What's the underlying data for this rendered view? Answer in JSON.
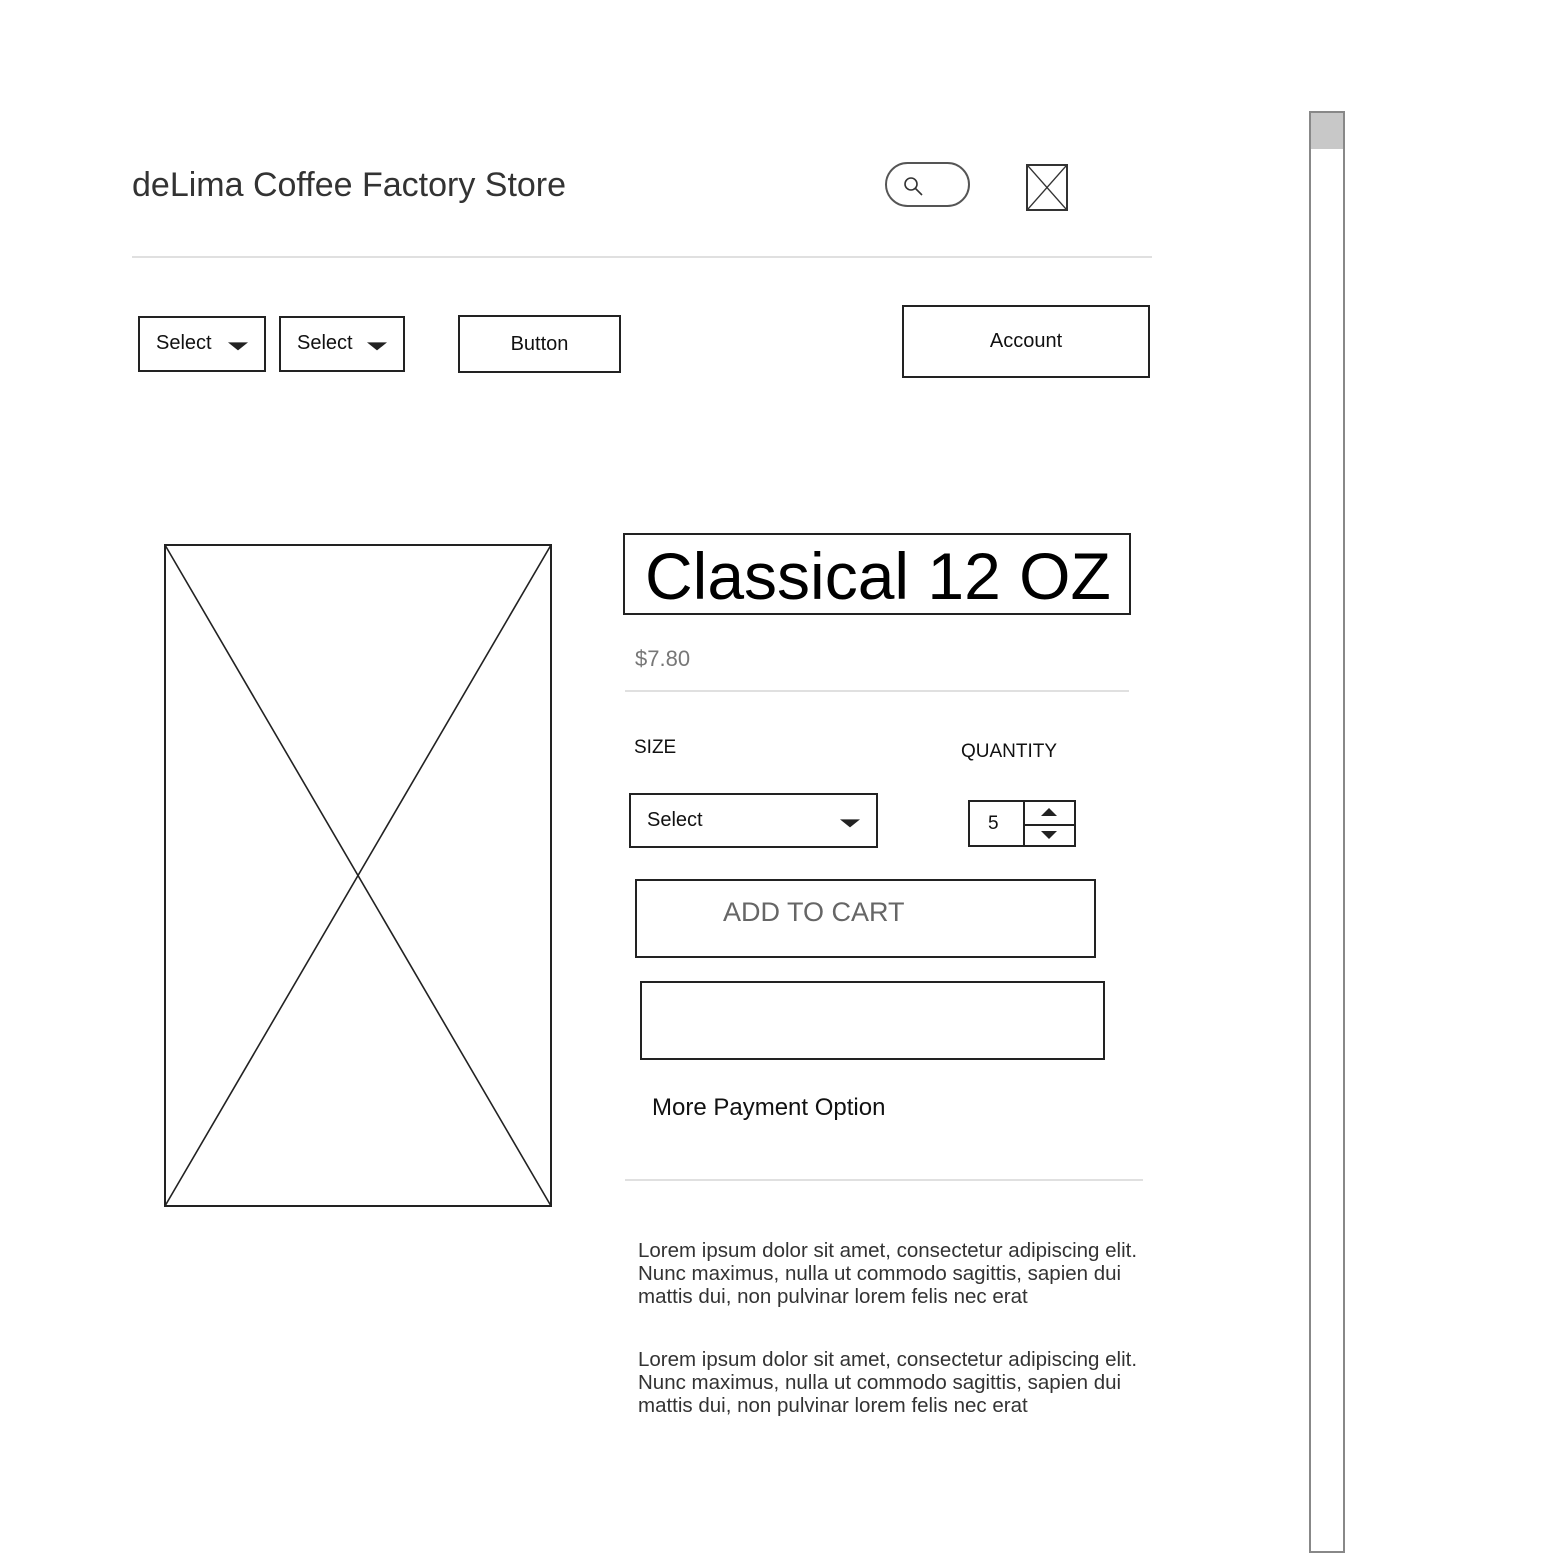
{
  "header": {
    "store_title": "deLima Coffee Factory Store",
    "search_icon": "search-icon",
    "cart_icon": "image-placeholder-icon"
  },
  "nav": {
    "select_1": "Select",
    "select_2": "Select",
    "button": "Button",
    "account": "Account"
  },
  "product": {
    "image": "image-placeholder",
    "title": "Classical 12 OZ",
    "price": "$7.80",
    "size_label": "SIZE",
    "size_value": "Select",
    "quantity_label": "QUANTITY",
    "quantity_value": "5",
    "add_to_cart": "ADD TO CART",
    "more_payment": "More Payment Option",
    "descriptions": [
      "Lorem ipsum dolor sit amet, consectetur adipiscing elit. Nunc maximus, nulla ut commodo sagittis, sapien dui mattis dui, non pulvinar lorem felis nec erat",
      "Lorem ipsum dolor sit amet, consectetur adipiscing elit. Nunc maximus, nulla ut commodo sagittis, sapien dui mattis dui, non pulvinar lorem felis nec erat"
    ]
  },
  "colors": {
    "border": "#222222",
    "muted_text": "#777777",
    "rule": "#e0e0e0",
    "scroll_thumb": "#c8c8c8"
  }
}
